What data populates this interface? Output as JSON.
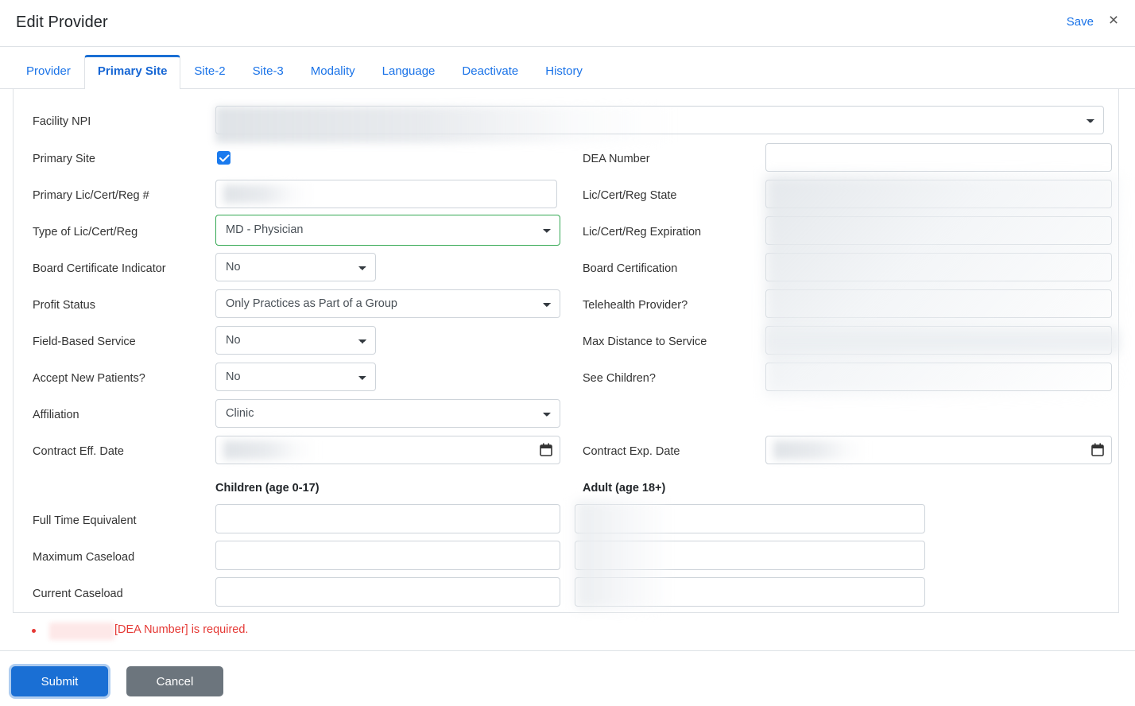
{
  "header": {
    "title": "Edit Provider",
    "save_label": "Save",
    "close_label": "×"
  },
  "tabs": [
    {
      "label": "Provider",
      "active": false
    },
    {
      "label": "Primary Site",
      "active": true
    },
    {
      "label": "Site-2",
      "active": false
    },
    {
      "label": "Site-3",
      "active": false
    },
    {
      "label": "Modality",
      "active": false
    },
    {
      "label": "Language",
      "active": false
    },
    {
      "label": "Deactivate",
      "active": false
    },
    {
      "label": "History",
      "active": false
    }
  ],
  "form": {
    "left_labels": {
      "facility_npi": "Facility NPI",
      "primary_site": "Primary Site",
      "primary_lic": "Primary Lic/Cert/Reg #",
      "type_lic": "Type of Lic/Cert/Reg",
      "board_cert_ind": "Board Certificate Indicator",
      "profit_status": "Profit Status",
      "field_based": "Field-Based Service",
      "accept_new": "Accept New Patients?",
      "affiliation": "Affiliation",
      "contract_eff": "Contract Eff. Date",
      "fte": "Full Time Equivalent",
      "max_caseload": "Maximum Caseload",
      "current_caseload": "Current Caseload"
    },
    "right_labels": {
      "dea_number": "DEA Number",
      "lic_state": "Lic/Cert/Reg State",
      "lic_expiration": "Lic/Cert/Reg Expiration",
      "board_certification": "Board Certification",
      "telehealth": "Telehealth Provider?",
      "max_distance": "Max Distance to Service",
      "see_children": "See Children?",
      "contract_exp": "Contract Exp. Date"
    },
    "values": {
      "facility_npi": "",
      "primary_site_checked": true,
      "primary_lic": "",
      "type_lic": "MD - Physician",
      "board_cert_ind": "No",
      "profit_status": "Only Practices as Part of a Group",
      "field_based": "No",
      "accept_new": "No",
      "affiliation": "Clinic",
      "contract_eff": "",
      "dea_number": "",
      "lic_state": "",
      "lic_expiration": "",
      "board_certification": "",
      "telehealth": "",
      "max_distance": "",
      "see_children": "",
      "contract_exp": "",
      "children_fte": "",
      "children_max_caseload": "",
      "children_current_caseload": "",
      "adult_fte": "",
      "adult_max_caseload": "",
      "adult_current_caseload": ""
    },
    "sections": {
      "children": "Children (age 0-17)",
      "adult": "Adult (age 18+)"
    }
  },
  "validation": {
    "error_text": "[DEA Number] is required."
  },
  "footer": {
    "submit_label": "Submit",
    "cancel_label": "Cancel"
  },
  "colors": {
    "accent": "#1a73e8",
    "active_tab": "#1666d4",
    "valid_border": "#34a853",
    "error": "#e53935",
    "submit_bg": "#1a6fd4",
    "cancel_bg": "#6c757d",
    "checkbox_bg": "#1a7aee"
  }
}
